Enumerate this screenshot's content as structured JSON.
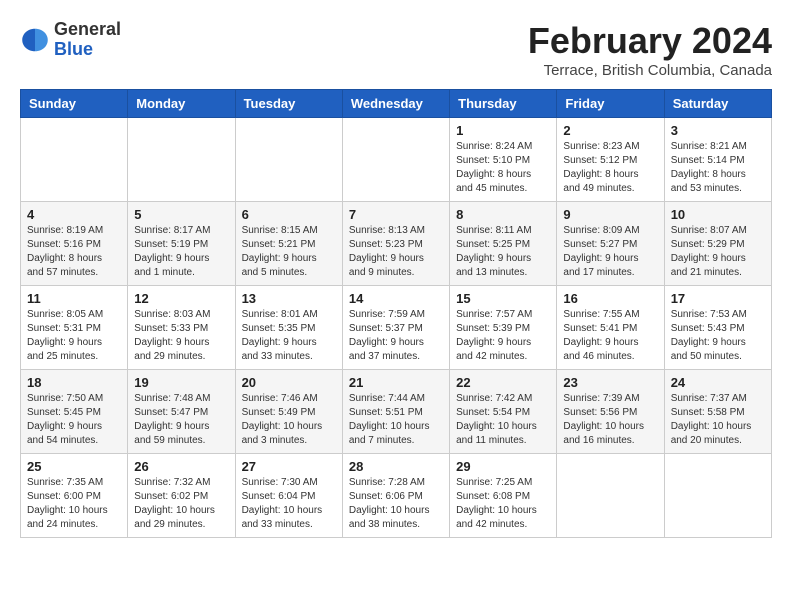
{
  "header": {
    "logo_line1": "General",
    "logo_line2": "Blue",
    "month_year": "February 2024",
    "location": "Terrace, British Columbia, Canada"
  },
  "weekdays": [
    "Sunday",
    "Monday",
    "Tuesday",
    "Wednesday",
    "Thursday",
    "Friday",
    "Saturday"
  ],
  "weeks": [
    [
      {
        "day": "",
        "info": ""
      },
      {
        "day": "",
        "info": ""
      },
      {
        "day": "",
        "info": ""
      },
      {
        "day": "",
        "info": ""
      },
      {
        "day": "1",
        "info": "Sunrise: 8:24 AM\nSunset: 5:10 PM\nDaylight: 8 hours\nand 45 minutes."
      },
      {
        "day": "2",
        "info": "Sunrise: 8:23 AM\nSunset: 5:12 PM\nDaylight: 8 hours\nand 49 minutes."
      },
      {
        "day": "3",
        "info": "Sunrise: 8:21 AM\nSunset: 5:14 PM\nDaylight: 8 hours\nand 53 minutes."
      }
    ],
    [
      {
        "day": "4",
        "info": "Sunrise: 8:19 AM\nSunset: 5:16 PM\nDaylight: 8 hours\nand 57 minutes."
      },
      {
        "day": "5",
        "info": "Sunrise: 8:17 AM\nSunset: 5:19 PM\nDaylight: 9 hours\nand 1 minute."
      },
      {
        "day": "6",
        "info": "Sunrise: 8:15 AM\nSunset: 5:21 PM\nDaylight: 9 hours\nand 5 minutes."
      },
      {
        "day": "7",
        "info": "Sunrise: 8:13 AM\nSunset: 5:23 PM\nDaylight: 9 hours\nand 9 minutes."
      },
      {
        "day": "8",
        "info": "Sunrise: 8:11 AM\nSunset: 5:25 PM\nDaylight: 9 hours\nand 13 minutes."
      },
      {
        "day": "9",
        "info": "Sunrise: 8:09 AM\nSunset: 5:27 PM\nDaylight: 9 hours\nand 17 minutes."
      },
      {
        "day": "10",
        "info": "Sunrise: 8:07 AM\nSunset: 5:29 PM\nDaylight: 9 hours\nand 21 minutes."
      }
    ],
    [
      {
        "day": "11",
        "info": "Sunrise: 8:05 AM\nSunset: 5:31 PM\nDaylight: 9 hours\nand 25 minutes."
      },
      {
        "day": "12",
        "info": "Sunrise: 8:03 AM\nSunset: 5:33 PM\nDaylight: 9 hours\nand 29 minutes."
      },
      {
        "day": "13",
        "info": "Sunrise: 8:01 AM\nSunset: 5:35 PM\nDaylight: 9 hours\nand 33 minutes."
      },
      {
        "day": "14",
        "info": "Sunrise: 7:59 AM\nSunset: 5:37 PM\nDaylight: 9 hours\nand 37 minutes."
      },
      {
        "day": "15",
        "info": "Sunrise: 7:57 AM\nSunset: 5:39 PM\nDaylight: 9 hours\nand 42 minutes."
      },
      {
        "day": "16",
        "info": "Sunrise: 7:55 AM\nSunset: 5:41 PM\nDaylight: 9 hours\nand 46 minutes."
      },
      {
        "day": "17",
        "info": "Sunrise: 7:53 AM\nSunset: 5:43 PM\nDaylight: 9 hours\nand 50 minutes."
      }
    ],
    [
      {
        "day": "18",
        "info": "Sunrise: 7:50 AM\nSunset: 5:45 PM\nDaylight: 9 hours\nand 54 minutes."
      },
      {
        "day": "19",
        "info": "Sunrise: 7:48 AM\nSunset: 5:47 PM\nDaylight: 9 hours\nand 59 minutes."
      },
      {
        "day": "20",
        "info": "Sunrise: 7:46 AM\nSunset: 5:49 PM\nDaylight: 10 hours\nand 3 minutes."
      },
      {
        "day": "21",
        "info": "Sunrise: 7:44 AM\nSunset: 5:51 PM\nDaylight: 10 hours\nand 7 minutes."
      },
      {
        "day": "22",
        "info": "Sunrise: 7:42 AM\nSunset: 5:54 PM\nDaylight: 10 hours\nand 11 minutes."
      },
      {
        "day": "23",
        "info": "Sunrise: 7:39 AM\nSunset: 5:56 PM\nDaylight: 10 hours\nand 16 minutes."
      },
      {
        "day": "24",
        "info": "Sunrise: 7:37 AM\nSunset: 5:58 PM\nDaylight: 10 hours\nand 20 minutes."
      }
    ],
    [
      {
        "day": "25",
        "info": "Sunrise: 7:35 AM\nSunset: 6:00 PM\nDaylight: 10 hours\nand 24 minutes."
      },
      {
        "day": "26",
        "info": "Sunrise: 7:32 AM\nSunset: 6:02 PM\nDaylight: 10 hours\nand 29 minutes."
      },
      {
        "day": "27",
        "info": "Sunrise: 7:30 AM\nSunset: 6:04 PM\nDaylight: 10 hours\nand 33 minutes."
      },
      {
        "day": "28",
        "info": "Sunrise: 7:28 AM\nSunset: 6:06 PM\nDaylight: 10 hours\nand 38 minutes."
      },
      {
        "day": "29",
        "info": "Sunrise: 7:25 AM\nSunset: 6:08 PM\nDaylight: 10 hours\nand 42 minutes."
      },
      {
        "day": "",
        "info": ""
      },
      {
        "day": "",
        "info": ""
      }
    ]
  ]
}
